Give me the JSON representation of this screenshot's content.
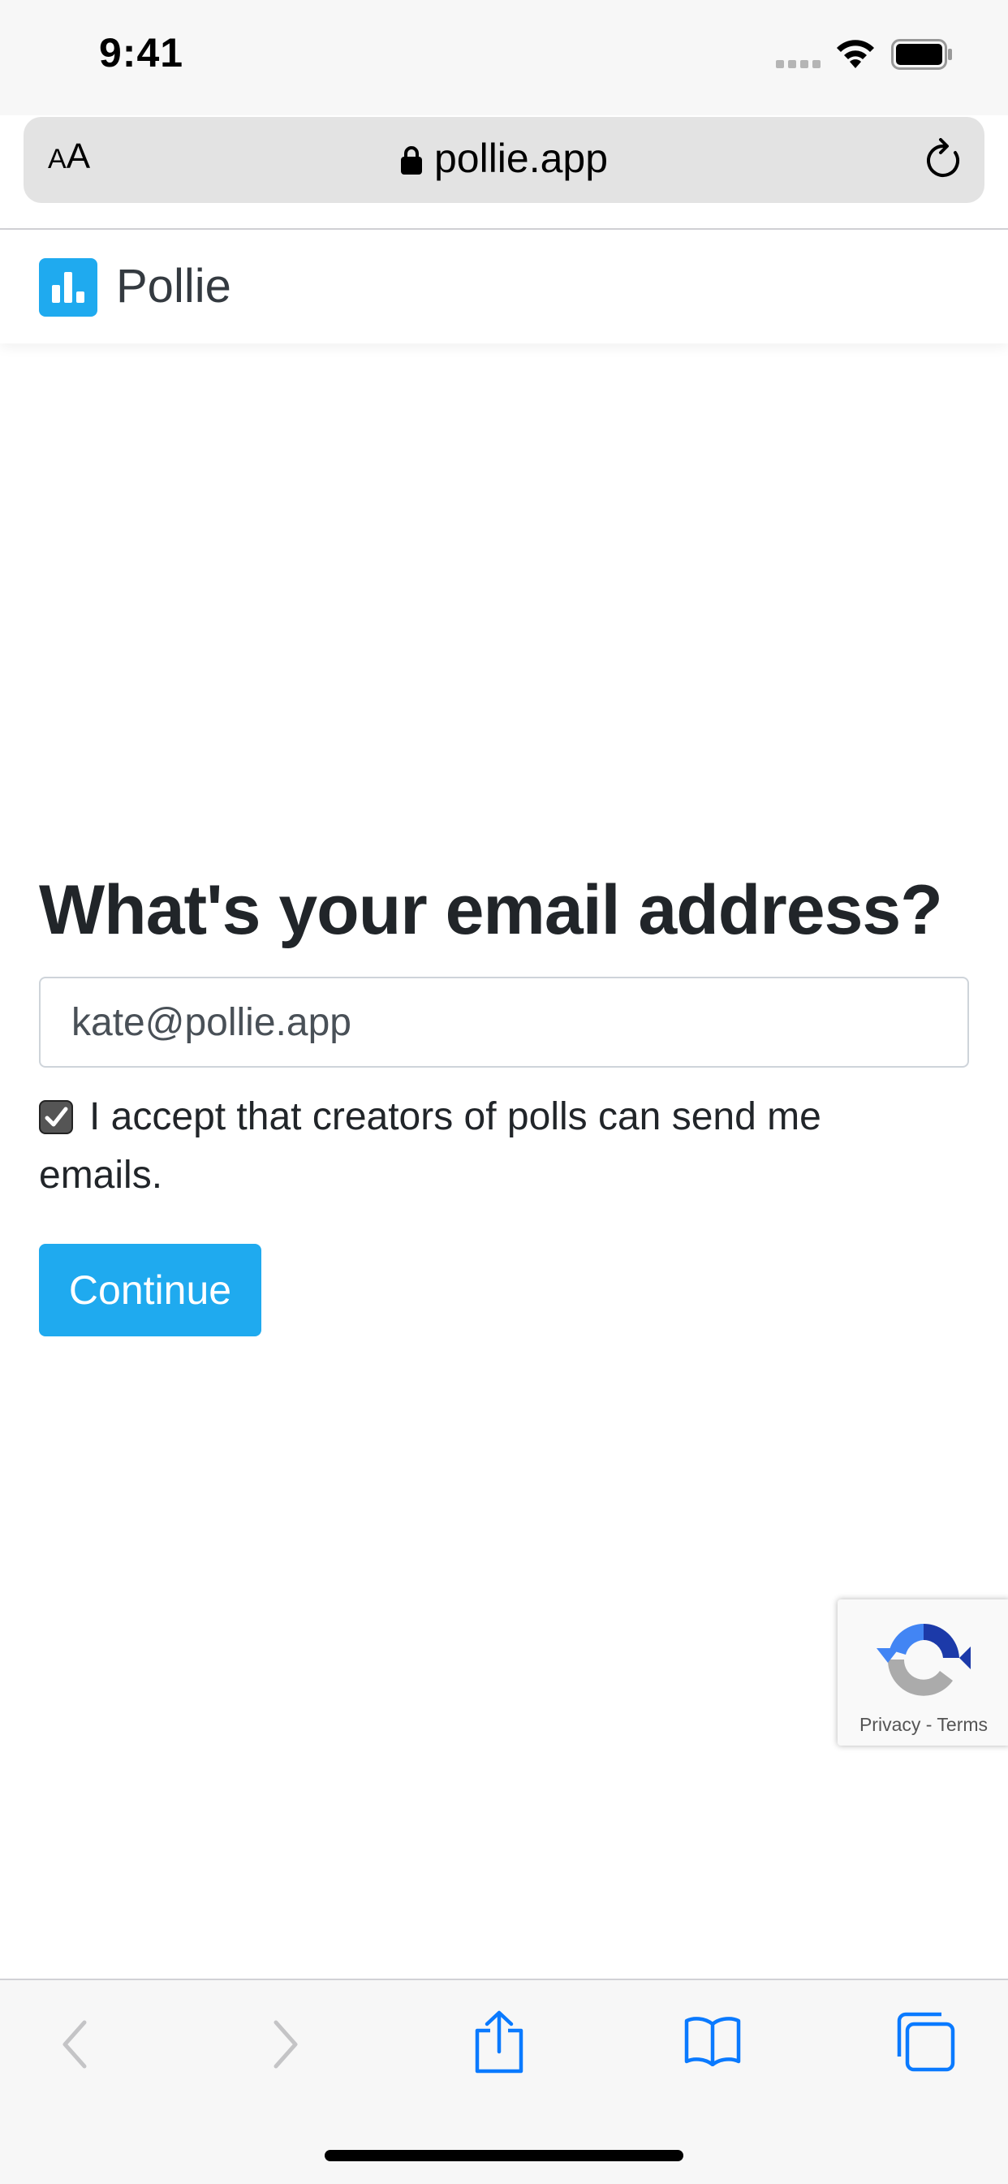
{
  "status_bar": {
    "time": "9:41"
  },
  "browser": {
    "text_size_label_small": "A",
    "text_size_label_large": "A",
    "url": "pollie.app"
  },
  "navbar": {
    "brand": "Pollie"
  },
  "form": {
    "heading": "What's your email address?",
    "email_value": "kate@pollie.app",
    "consent_checked": true,
    "consent_label": "I accept that creators of polls can send me emails.",
    "submit_label": "Continue"
  },
  "recaptcha": {
    "privacy": "Privacy",
    "separator": " - ",
    "terms": "Terms"
  },
  "colors": {
    "accent": "#1faaef",
    "toolbar_icon": "#0a7aff",
    "toolbar_disabled": "#c4c4c6"
  },
  "icons": [
    "lock-icon",
    "reload-icon",
    "wifi-icon",
    "battery-icon",
    "chart-logo-icon",
    "checkmark-icon",
    "recaptcha-icon",
    "back-icon",
    "forward-icon",
    "share-icon",
    "bookmarks-icon",
    "tabs-icon"
  ]
}
